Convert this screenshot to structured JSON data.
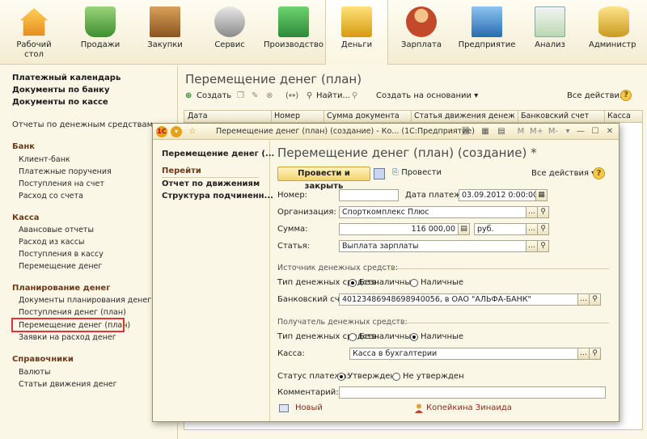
{
  "toolbar": {
    "items": [
      {
        "label": "Рабочий\nстол",
        "line1": "Рабочий",
        "line2": "стол"
      },
      {
        "label": "Продажи"
      },
      {
        "label": "Закупки"
      },
      {
        "label": "Сервис"
      },
      {
        "label": "Производство"
      },
      {
        "label": "Деньги"
      },
      {
        "label": "Зарплата"
      },
      {
        "label": "Предприятие"
      },
      {
        "label": "Анализ"
      },
      {
        "label": "Администр"
      }
    ]
  },
  "leftnav": {
    "top_links": [
      "Платежный календарь",
      "Документы по банку",
      "Документы по кассе"
    ],
    "reports": "Отчеты по денежным средствам",
    "groups": [
      {
        "title": "Банк",
        "items": [
          "Клиент-банк",
          "Платежные поручения",
          "Поступления на счет",
          "Расход со счета"
        ]
      },
      {
        "title": "Касса",
        "items": [
          "Авансовые отчеты",
          "Расход из кассы",
          "Поступления в кассу",
          "Перемещение денег"
        ]
      },
      {
        "title": "Планирование денег",
        "items": [
          "Документы планирования денег",
          "Поступления денег (план)",
          "Перемещение денег (план)",
          "Заявки на расход денег"
        ]
      },
      {
        "title": "Справочники",
        "items": [
          "Валюты",
          "Статьи движения денег"
        ]
      }
    ]
  },
  "list": {
    "title": "Перемещение денег (план)",
    "create": "Создать",
    "find": "Найти...",
    "create_based_on": "Создать на основании",
    "all_actions": "Все действия",
    "columns": [
      "Дата",
      "Номер",
      "Сумма документа",
      "Статья движения денежных...",
      "Банковский счет",
      "Касса"
    ]
  },
  "dialog": {
    "window_title": "Перемещение денег (план) (создание) - Ко... (1С:Предприятие)",
    "left_title": "Перемещение денег (...",
    "go_to": "Перейти",
    "nav_items": [
      "Отчет по движениям",
      "Структура подчиненн..."
    ],
    "title": "Перемещение денег (план) (создание) *",
    "btn_post_close": "Провести и закрыть",
    "btn_post": "Провести",
    "all_actions": "Все действия",
    "help": "?",
    "fields": {
      "number_label": "Номер:",
      "number_value": "",
      "date_label": "Дата платежа:",
      "date_value": "03.09.2012  0:00:00",
      "org_label": "Организация:",
      "org_value": "Спорткомплекс Плюс",
      "sum_label": "Сумма:",
      "sum_value": "116 000,00",
      "currency_value": "руб.",
      "article_label": "Статья:",
      "article_value": "Выплата зарплаты"
    },
    "source": {
      "title": "Источник денежных средств:",
      "type_label": "Тип денежных средств:",
      "opt1": "Безналичные",
      "opt2": "Наличные",
      "selected": "Безналичные",
      "account_label": "Банковский счет:",
      "account_value": "40123486948698940056, в ОАО \"АЛЬФА-БАНК\""
    },
    "receiver": {
      "title": "Получатель денежных средств:",
      "type_label": "Тип денежных средств:",
      "opt1": "Безналичные",
      "opt2": "Наличные",
      "selected": "Наличные",
      "cash_label": "Касса:",
      "cash_value": "Касса в бухгалтерии"
    },
    "status": {
      "label": "Статус платежа:",
      "opt1": "Утвержден",
      "opt2": "Не утвержден",
      "selected": "Утвержден"
    },
    "comment_label": "Комментарий:",
    "comment_value": "",
    "footer": {
      "state": "Новый",
      "user": "Копейкина Зинаида"
    }
  }
}
